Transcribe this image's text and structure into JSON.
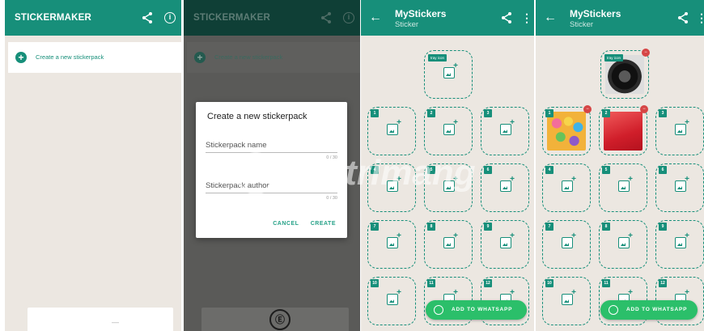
{
  "colors": {
    "accent": "#178f7a",
    "accent_dark": "#0f3f36",
    "whatsapp_green": "#2bbf6a",
    "delete_red": "#d64545"
  },
  "panel1": {
    "app_title": "STICKERMAKER",
    "create_label": "Create a new stickerpack",
    "bottom_dash": "—"
  },
  "panel2": {
    "app_title": "STICKERMAKER",
    "create_label": "Create a new stickerpack",
    "dialog": {
      "title": "Create a new stickerpack",
      "name_placeholder": "Stickerpack name",
      "name_counter": "0 / 30",
      "author_placeholder": "Stickerpack author",
      "author_counter": "0 / 30",
      "cancel": "CANCEL",
      "create": "CREATE"
    }
  },
  "panel3": {
    "title": "MyStickers",
    "subtitle": "Sticker",
    "tray_label": "tray icon",
    "tile_numbers": [
      "1",
      "2",
      "3",
      "4",
      "5",
      "6",
      "7",
      "8",
      "9",
      "10",
      "11",
      "12"
    ],
    "add_button": "ADD TO WHATSAPP"
  },
  "panel4": {
    "title": "MyStickers",
    "subtitle": "Sticker",
    "tray_label": "tray icon",
    "tile_numbers": [
      "1",
      "2",
      "3",
      "4",
      "5",
      "6",
      "7",
      "8",
      "9",
      "10",
      "11",
      "12"
    ],
    "add_button": "ADD TO WHATSAPP"
  },
  "watermark": {
    "text": "uantrimang"
  },
  "icons": {
    "share": "share-icon",
    "info": "info-icon",
    "back": "arrow-back-icon",
    "more": "more-vert-icon",
    "add": "add-circle-icon",
    "add_image": "add-image-icon",
    "whatsapp": "whatsapp-icon",
    "delete": "delete-badge-icon"
  }
}
